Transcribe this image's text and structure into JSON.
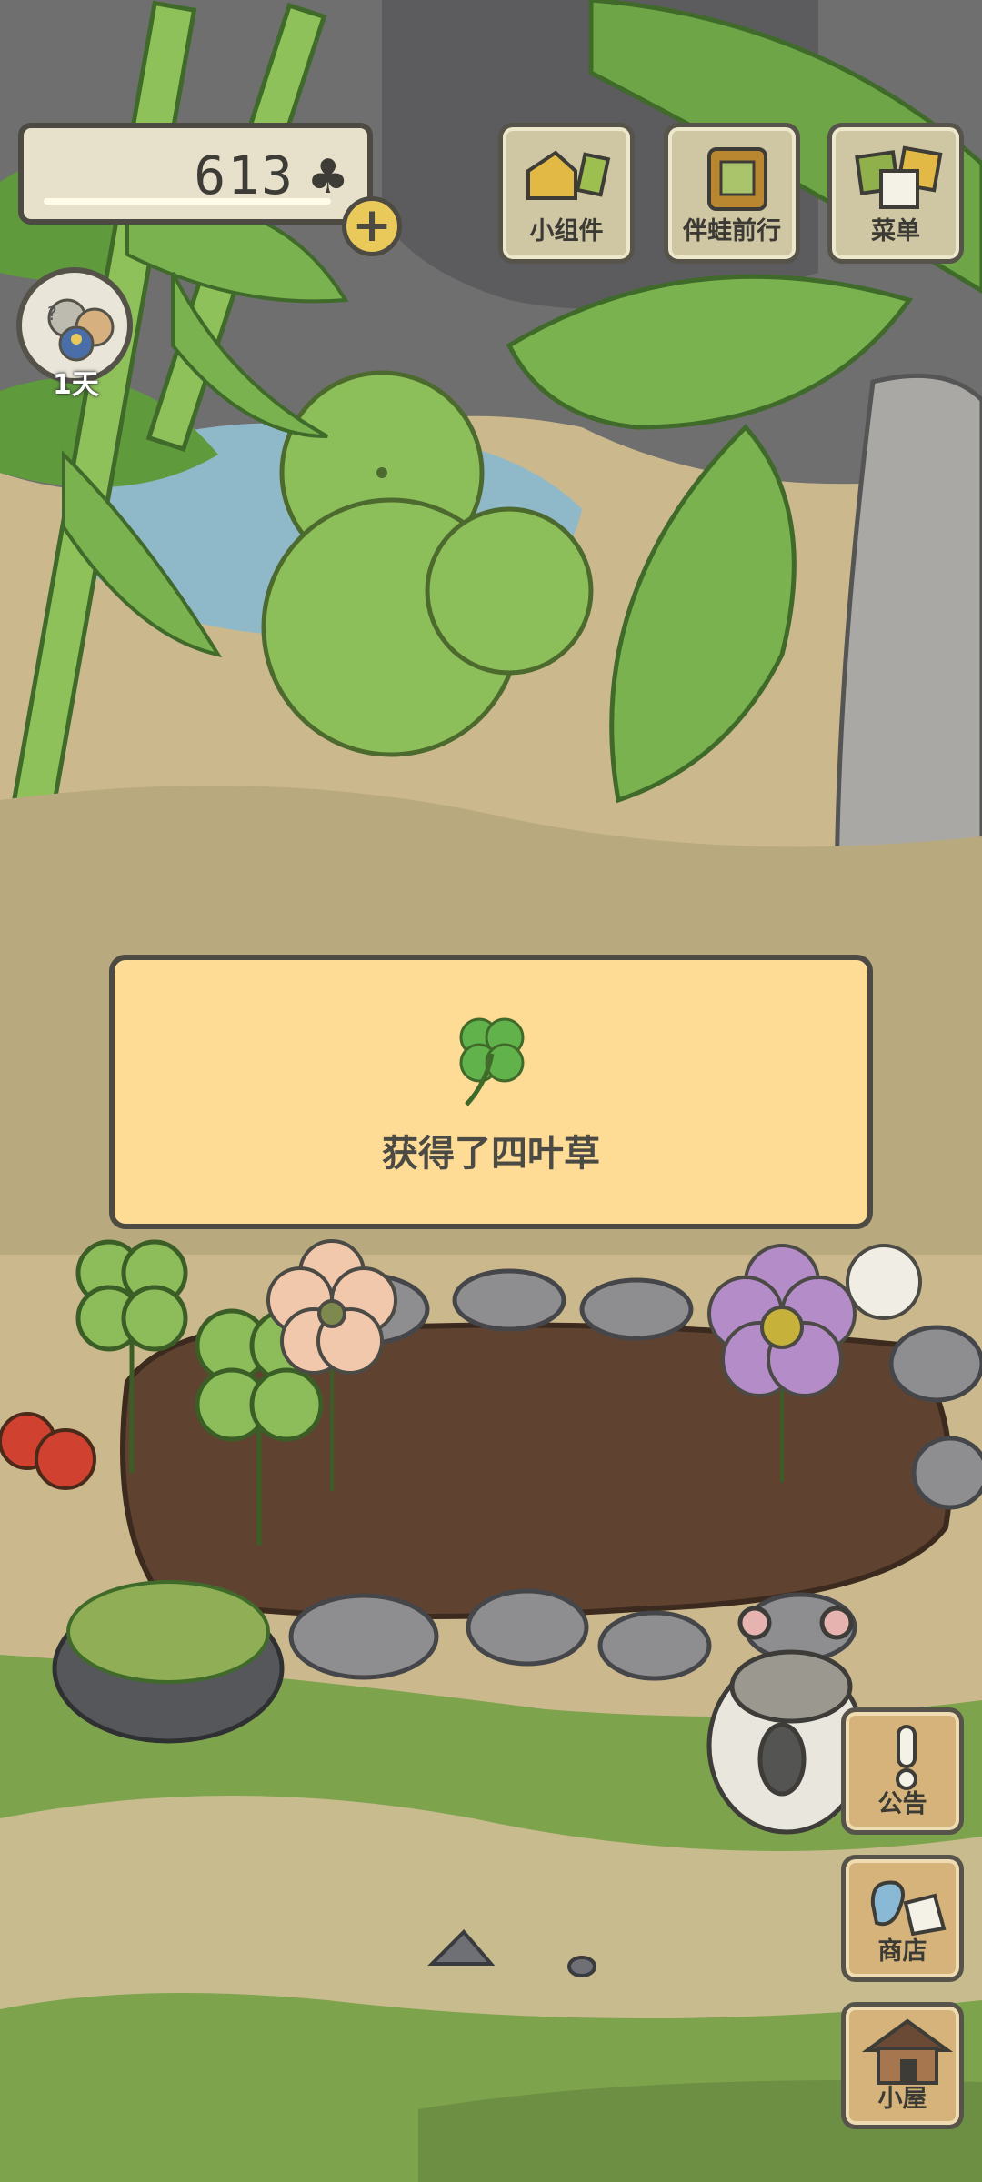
{
  "hud": {
    "clover_count": "613",
    "clover_symbol": "♣",
    "plus_label": "+",
    "visitor_days": "1天"
  },
  "top_menu": {
    "items": [
      {
        "label": "小组件",
        "icon": "widget-icon"
      },
      {
        "label": "伴蛙前行",
        "icon": "frog-journey-icon"
      },
      {
        "label": "菜单",
        "icon": "menu-icon"
      }
    ]
  },
  "side_menu": {
    "items": [
      {
        "label": "公告",
        "icon": "notice-icon"
      },
      {
        "label": "商店",
        "icon": "shop-icon"
      },
      {
        "label": "小屋",
        "icon": "house-icon"
      }
    ]
  },
  "dialog": {
    "message": "获得了四叶草",
    "icon": "four-leaf-clover-icon"
  },
  "colors": {
    "dialog_bg": "#fedc96",
    "outline": "#4c4a42",
    "grass": "#7da34d",
    "soil": "#5f4330",
    "path": "#cbb98d"
  }
}
